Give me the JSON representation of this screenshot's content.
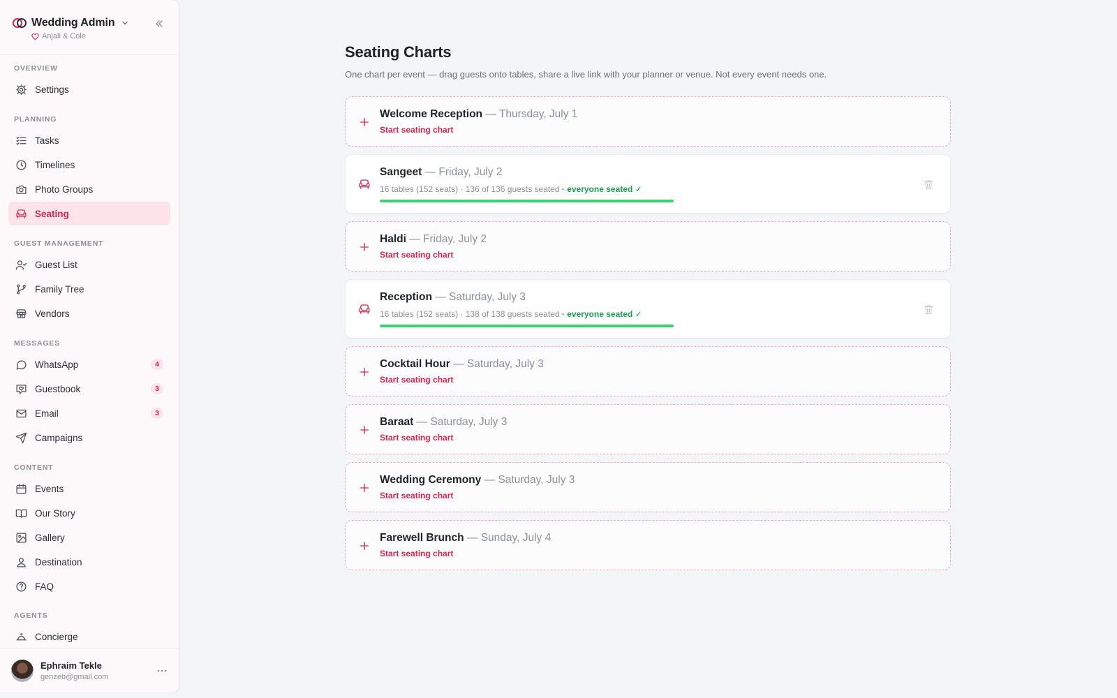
{
  "sidebar": {
    "brand": {
      "title": "Wedding Admin",
      "couple": "Anjali & Cole"
    },
    "sections": [
      {
        "label": "Overview",
        "items": [
          {
            "label": "Settings",
            "icon": "gear-icon"
          }
        ]
      },
      {
        "label": "Planning",
        "items": [
          {
            "label": "Tasks",
            "icon": "checklist-icon"
          },
          {
            "label": "Timelines",
            "icon": "clock-icon"
          },
          {
            "label": "Photo Groups",
            "icon": "camera-icon"
          },
          {
            "label": "Seating",
            "icon": "armchair-icon",
            "active": true
          }
        ]
      },
      {
        "label": "Guest Management",
        "items": [
          {
            "label": "Guest List",
            "icon": "user-check-icon"
          },
          {
            "label": "Family Tree",
            "icon": "git-branch-icon"
          },
          {
            "label": "Vendors",
            "icon": "store-icon"
          }
        ]
      },
      {
        "label": "Messages",
        "items": [
          {
            "label": "WhatsApp",
            "icon": "chat-bubble-icon",
            "badge": "4"
          },
          {
            "label": "Guestbook",
            "icon": "heart-message-icon",
            "badge": "3"
          },
          {
            "label": "Email",
            "icon": "mail-icon",
            "badge": "3"
          },
          {
            "label": "Campaigns",
            "icon": "send-icon"
          }
        ]
      },
      {
        "label": "Content",
        "items": [
          {
            "label": "Events",
            "icon": "calendar-icon"
          },
          {
            "label": "Our Story",
            "icon": "book-icon"
          },
          {
            "label": "Gallery",
            "icon": "image-icon"
          },
          {
            "label": "Destination",
            "icon": "map-pin-user-icon"
          },
          {
            "label": "FAQ",
            "icon": "help-circle-icon"
          }
        ]
      },
      {
        "label": "Agents",
        "items": [
          {
            "label": "Concierge",
            "icon": "concierge-bell-icon"
          }
        ]
      }
    ],
    "user": {
      "name": "Ephraim Tekle",
      "email": "genzeb@gmail.com"
    }
  },
  "main": {
    "title": "Seating Charts",
    "description": "One chart per event — drag guests onto tables, share a live link with your planner or venue. Not every event needs one.",
    "start_label": "Start seating chart",
    "events": [
      {
        "name": "Welcome Reception",
        "date": "— Thursday, July 1",
        "has_chart": false
      },
      {
        "name": "Sangeet",
        "date": "— Friday, July 2",
        "has_chart": true,
        "stats": "16 tables (152 seats) · 136 of 136 guests seated",
        "status": "· everyone seated ✓",
        "progress": 1.0
      },
      {
        "name": "Haldi",
        "date": "— Friday, July 2",
        "has_chart": false
      },
      {
        "name": "Reception",
        "date": "— Saturday, July 3",
        "has_chart": true,
        "stats": "16 tables (152 seats) · 138 of 138 guests seated",
        "status": "· everyone seated ✓",
        "progress": 1.0
      },
      {
        "name": "Cocktail Hour",
        "date": "— Saturday, July 3",
        "has_chart": false
      },
      {
        "name": "Baraat",
        "date": "— Saturday, July 3",
        "has_chart": false
      },
      {
        "name": "Wedding Ceremony",
        "date": "— Saturday, July 3",
        "has_chart": false
      },
      {
        "name": "Farewell Brunch",
        "date": "— Sunday, July 4",
        "has_chart": false
      }
    ]
  },
  "colors": {
    "accent": "#d4264f",
    "accent_bg": "#fde4ea",
    "success": "#1e9c4f",
    "progress": "#3ecf71"
  }
}
